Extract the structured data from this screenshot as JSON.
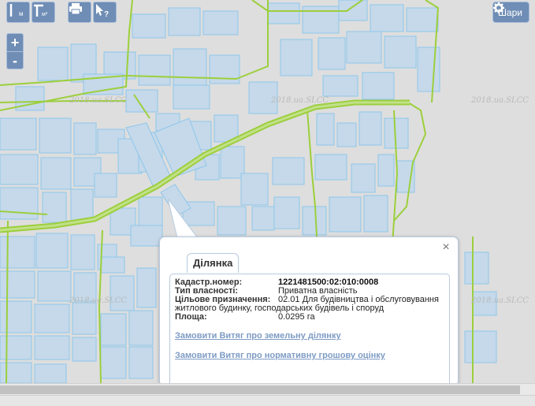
{
  "toolbar": {
    "tools": [
      {
        "name": "measure-length-icon",
        "sub": "м"
      },
      {
        "name": "measure-area-icon",
        "sub": "м²"
      },
      {
        "name": "print-icon",
        "sub": ""
      },
      {
        "name": "identify-icon",
        "sub": "?"
      }
    ],
    "layers_label": "Шари"
  },
  "zoom": {
    "in": "+",
    "out": "-"
  },
  "watermark": "2018.ua.SLCC",
  "popup": {
    "tab_label": "Ділянка",
    "close": "×",
    "fields": {
      "cadastral_label": "Кадастр.номер:",
      "cadastral_value": "1221481500:02:010:0008",
      "ownership_label": "Тип власності:",
      "ownership_value": "Приватна власність",
      "purpose_label": "Цільове призначення:",
      "purpose_value": "02.01 Для будівництва і обслуговування житлового будинку, господарських будівель і споруд",
      "area_label": "Площа:",
      "area_value": "0.0295 га"
    },
    "link_land_extract": "Замовити Витяг про земельну ділянку",
    "link_normative_valuation": "Замовити Витяг про нормативну грошову оцінку"
  },
  "colors": {
    "map_bg": "#dedede",
    "parcel_fill": "#c5d9ea",
    "parcel_stroke": "#8ec6ea",
    "boundary_green": "#9ccf3c",
    "button_bg": "#6f8db5"
  }
}
